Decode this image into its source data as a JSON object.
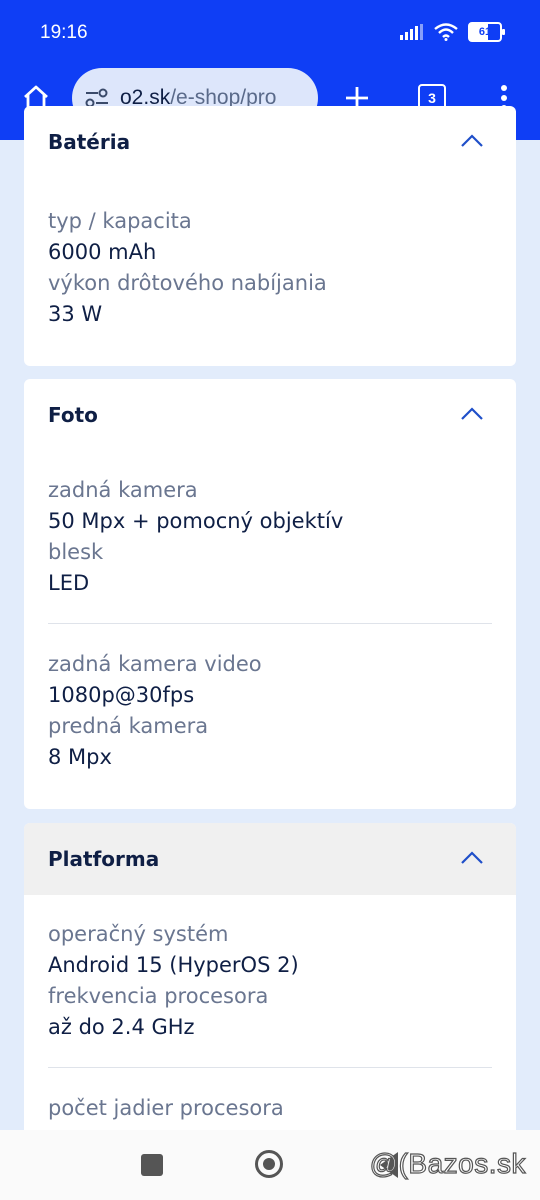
{
  "status_bar": {
    "time": "19:16",
    "battery_level": "61",
    "icons": [
      "signal-icon",
      "wifi-icon",
      "battery-icon"
    ]
  },
  "browser": {
    "url_domain": "o2.sk",
    "url_path": "/e-shop/pro",
    "tab_count": "3",
    "accent": "#0f3ef5"
  },
  "sections": {
    "bateria": {
      "title": "Batéria",
      "specs": [
        {
          "label": "typ / kapacita",
          "value": "6000 mAh"
        },
        {
          "label": "výkon drôtového nabíjania",
          "value": "33 W"
        }
      ]
    },
    "foto": {
      "title": "Foto",
      "specs": [
        {
          "label": "zadná kamera",
          "value": "50 Mpx + pomocný objektív"
        },
        {
          "label": "blesk",
          "value": "LED"
        },
        {
          "label": "zadná kamera video",
          "value": "1080p@30fps"
        },
        {
          "label": "predná kamera",
          "value": "8 Mpx"
        }
      ]
    },
    "platforma": {
      "title": "Platforma",
      "specs": [
        {
          "label": "operačný systém",
          "value": "Android 15 (HyperOS 2)"
        },
        {
          "label": "frekvencia procesora",
          "value": "až do 2.4 GHz"
        },
        {
          "label": "počet jadier procesora",
          "value": ""
        }
      ]
    }
  },
  "watermark": "@(Bazos.sk"
}
